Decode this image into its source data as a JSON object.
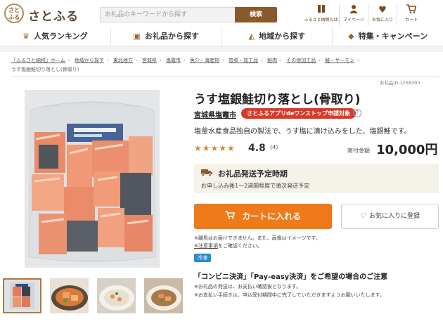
{
  "header": {
    "logo_mark": "さと\nふる",
    "logo_text": "さとふる",
    "search_placeholder": "お礼品のキーワードから探す",
    "search_button": "検索",
    "icons": [
      {
        "icon": "book-icon",
        "label": "ふるさと納税とは"
      },
      {
        "icon": "person-icon",
        "label": "マイページ"
      },
      {
        "icon": "heart-icon",
        "label": "お気に入り"
      },
      {
        "icon": "cart-icon",
        "label": "カート"
      }
    ]
  },
  "nav": [
    {
      "icon": "crown-icon",
      "label": "人気ランキング"
    },
    {
      "icon": "gift-icon",
      "label": "お礼品から探す"
    },
    {
      "icon": "map-icon",
      "label": "地域から探す"
    },
    {
      "icon": "tag-icon",
      "label": "特集・キャンペーン"
    }
  ],
  "breadcrumb": [
    "「ふるさと納税」ホーム",
    "地域から探す",
    "東北地方",
    "宮城県",
    "塩竈市",
    "魚介・海産物",
    "惣菜・加工品",
    "鮭肉",
    "その他加工品",
    "鮭・サーモン"
  ],
  "breadcrumb_current": "うす塩銀鮭切り落とし(骨取り)",
  "item_id": "お礼品ID:1258303",
  "product": {
    "title": "うす塩銀鮭切り落とし(骨取り)",
    "municipality": "宮城県塩竈市",
    "app_badge": "さとふるアプリdeワンストップ申請対象",
    "help": "?",
    "description": "塩釜水産食品独自の製法で、うす塩に漬け込みをした、塩銀鮭です。",
    "stars": "★★★★★",
    "rating": "4.8",
    "rating_count": "(4)",
    "price_label": "寄付金額",
    "price": "10,000円"
  },
  "shipping": {
    "title": "お礼品発送予定時期",
    "detail": "お申し込み後1～2週間程度で順次発送予定"
  },
  "cart_button": "カートに入れる",
  "favorite_button": "お気に入りに登録",
  "notes": {
    "line1": "※離島はお届けできません。また、画像はイメージです。",
    "line2_link": "※注意事項",
    "line2_rest": "をご確認ください。"
  },
  "cold_badge": "冷凍",
  "payment": {
    "title": "「コンビニ決済」「Pay-easy決済」をご希望の場合のご注意",
    "line1": "※お礼品の発送は、お支払い確認後となります。",
    "line2": "※お支払い手続きは、申込受付期間中に完了していただきますようお願いいたします。"
  },
  "colors": {
    "brand_brown": "#8b5a2b",
    "cart_orange": "#ef7a1a",
    "badge_red": "#d63a2a",
    "star_gold": "#c88b30",
    "cold_blue": "#2a8bd0"
  }
}
